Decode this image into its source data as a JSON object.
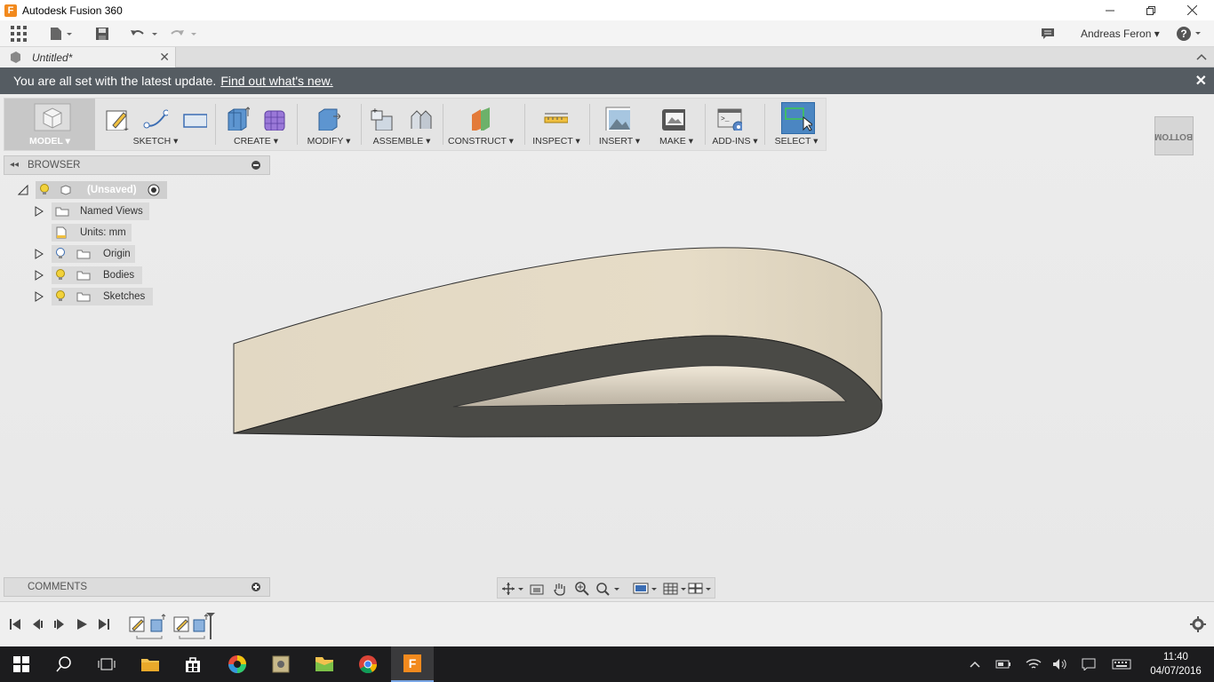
{
  "window": {
    "title": "Autodesk Fusion 360",
    "app_icon_letter": "F"
  },
  "qat": {
    "user": "Andreas Feron",
    "help": "?"
  },
  "document_tab": {
    "title": "Untitled*",
    "close": "✕"
  },
  "banner": {
    "message": "You are all set with the latest update.",
    "link": "Find out what's new.",
    "close": "✕"
  },
  "toolbar": {
    "model": "MODEL ▾",
    "sketch": "SKETCH ▾",
    "create": "CREATE ▾",
    "modify": "MODIFY ▾",
    "assemble": "ASSEMBLE ▾",
    "construct": "CONSTRUCT ▾",
    "inspect": "INSPECT ▾",
    "insert": "INSERT ▾",
    "make": "MAKE ▾",
    "addins": "ADD-INS ▾",
    "select": "SELECT ▾"
  },
  "viewcube": {
    "face": "BOTTOM"
  },
  "browser": {
    "title": "BROWSER",
    "root": "(Unsaved)",
    "items": {
      "named_views": "Named Views",
      "units": "Units: mm",
      "origin": "Origin",
      "bodies": "Bodies",
      "sketches": "Sketches"
    }
  },
  "comments": {
    "title": "COMMENTS"
  },
  "taskbar": {
    "time": "11:40",
    "date": "04/07/2016"
  },
  "colors": {
    "banner": "#555c62",
    "body_top": "#e2d8c3",
    "body_inner": "#4c4c47",
    "accent": "#4b86c2"
  }
}
